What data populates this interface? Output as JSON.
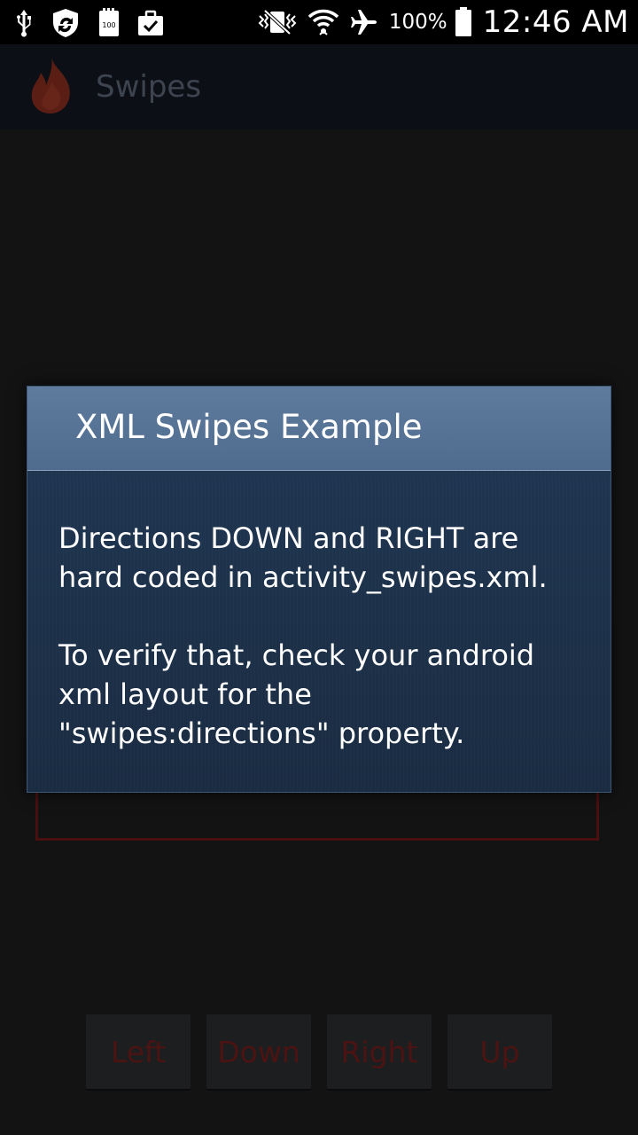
{
  "status_bar": {
    "icons_left": [
      "usb-icon",
      "shield-sync-icon",
      "storage-100-icon",
      "briefcase-check-icon"
    ],
    "icons_right": [
      "vibrate-mute-icon",
      "wifi-icon",
      "airplane-icon"
    ],
    "battery_percent": "100%",
    "time": "12:46 AM"
  },
  "action_bar": {
    "title": "Swipes",
    "logo_icon": "flame-icon"
  },
  "dialog": {
    "title": "XML Swipes Example",
    "message_1": "Directions DOWN and RIGHT are\nhard coded in activity_swipes.xml.",
    "message_2": "To verify that, check your android\nxml layout for the\n\"swipes:directions\" property."
  },
  "buttons": {
    "left": "Left",
    "down": "Down",
    "right": "Right",
    "up": "Up"
  },
  "colors": {
    "dialog_header": "#5e7b9d",
    "dialog_body": "#1d3047",
    "button_text": "#4c1313",
    "swipe_border": "#4a1010",
    "background": "#131314"
  }
}
